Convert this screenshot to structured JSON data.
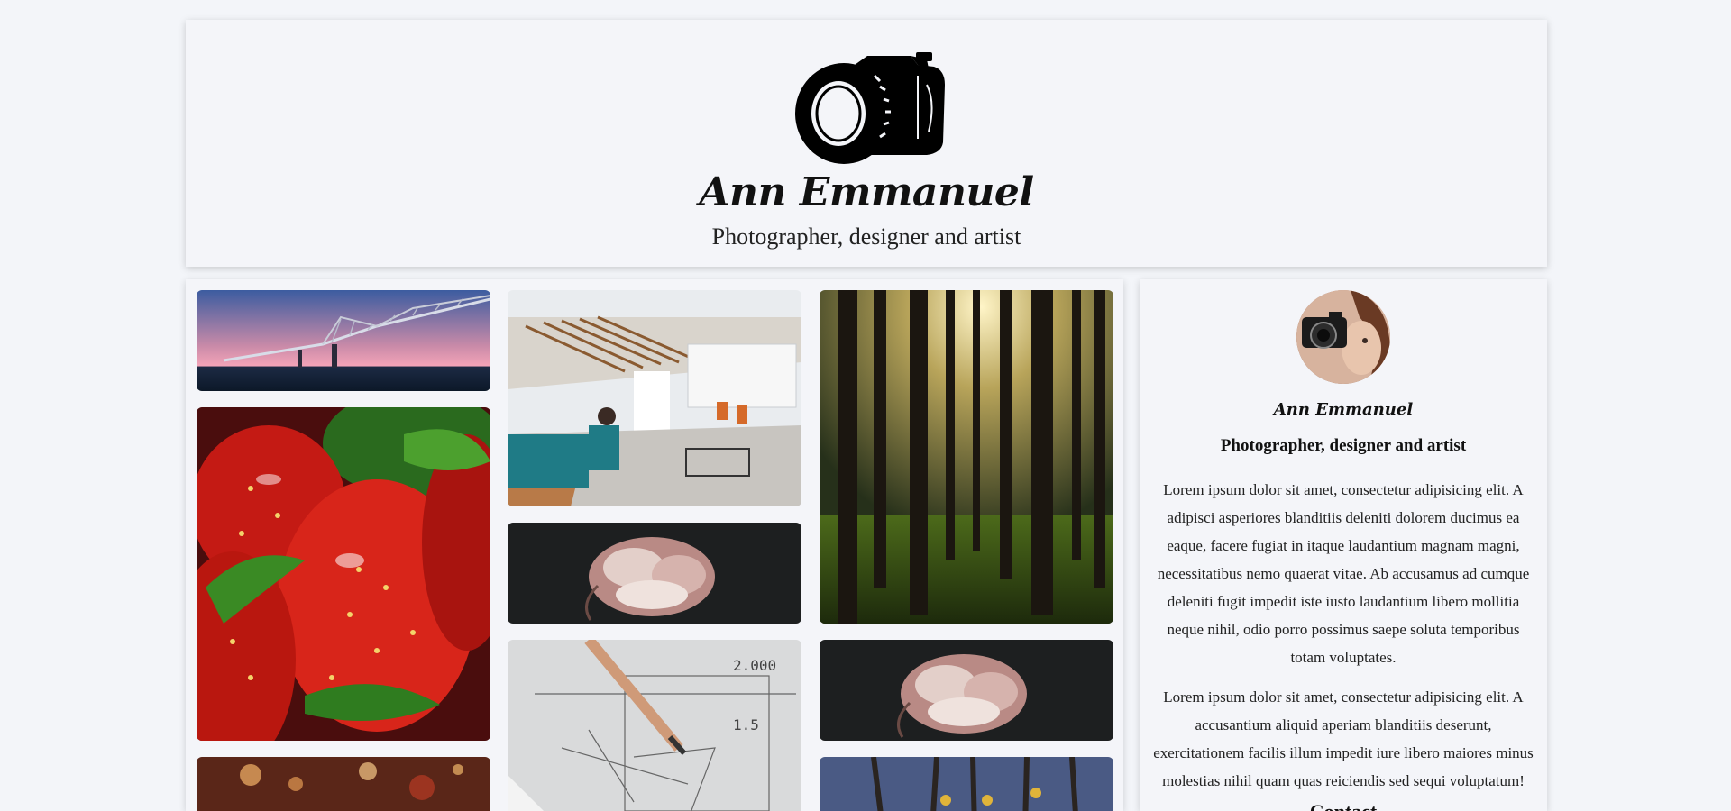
{
  "header": {
    "logo_icon": "camera-logo-icon",
    "title": "Ann Emmanuel",
    "subtitle": "Photographer, designer and artist"
  },
  "gallery": {
    "photos": [
      {
        "name": "bridge-sunset",
        "alt": "bridge-photo"
      },
      {
        "name": "office-lobby",
        "alt": "office-photo"
      },
      {
        "name": "forest-sunlight",
        "alt": "forest-photo"
      },
      {
        "name": "strawberries",
        "alt": "strawberries-photo"
      },
      {
        "name": "peony-flower",
        "alt": "flower-photo"
      },
      {
        "name": "peony-flower-2",
        "alt": "flower-photo"
      },
      {
        "name": "blueprint-pencil",
        "alt": "blueprint-photo"
      },
      {
        "name": "bokeh-lights",
        "alt": "bokeh-photo"
      },
      {
        "name": "denim-pins",
        "alt": "denim-photo"
      }
    ]
  },
  "sidebar": {
    "avatar_icon": "profile-avatar",
    "name": "Ann Emmanuel",
    "role": "Photographer, designer and artist",
    "paragraph1": "Lorem ipsum dolor sit amet, consectetur adipisicing elit. A adipisci asperiores blanditiis deleniti dolorem ducimus ea eaque, facere fugiat in itaque laudantium magnam magni, necessitatibus nemo quaerat vitae. Ab accusamus ad cumque deleniti fugit impedit iste iusto laudantium libero mollitia neque nihil, odio porro possimus saepe soluta temporibus totam voluptates.",
    "paragraph2": "Lorem ipsum dolor sit amet, consectetur adipisicing elit. A accusantium aliquid aperiam blanditiis deserunt, exercitationem facilis illum impedit iure libero maiores minus molestias nihil quam quas reiciendis sed sequi voluptatum!",
    "heading_partial": "Contact"
  },
  "colors": {
    "background": "#f3f5f9",
    "card": "#f4f5f9",
    "text": "#111111"
  }
}
